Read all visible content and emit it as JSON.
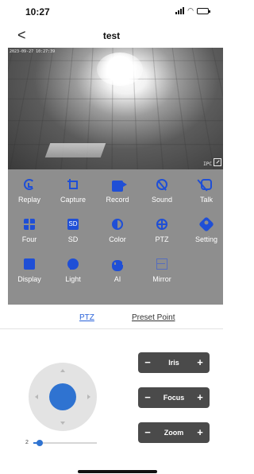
{
  "status_bar": {
    "time": "10:27"
  },
  "nav": {
    "back_glyph": "<",
    "title": "test"
  },
  "video": {
    "osd_top_left": "2023-09-27 10:27:39",
    "osd_bottom_right": "IPC"
  },
  "controls": {
    "row1": [
      {
        "label": "Replay",
        "icon": "replay-icon"
      },
      {
        "label": "Capture",
        "icon": "capture-icon"
      },
      {
        "label": "Record",
        "icon": "record-icon"
      },
      {
        "label": "Sound",
        "icon": "sound-off-icon"
      },
      {
        "label": "Talk",
        "icon": "talk-off-icon"
      }
    ],
    "row2": [
      {
        "label": "Four",
        "icon": "four-grid-icon"
      },
      {
        "label": "SD",
        "icon": "sd-icon",
        "badge": "SD"
      },
      {
        "label": "Color",
        "icon": "color-icon"
      },
      {
        "label": "PTZ",
        "icon": "ptz-icon"
      },
      {
        "label": "Setting",
        "icon": "gear-icon"
      }
    ],
    "row3": [
      {
        "label": "Display",
        "icon": "display-icon"
      },
      {
        "label": "Light",
        "icon": "light-bulb-icon"
      },
      {
        "label": "AI",
        "icon": "ai-icon"
      },
      {
        "label": "Mirror",
        "icon": "mirror-icon"
      }
    ]
  },
  "tabs": {
    "ptz": "PTZ",
    "preset": "Preset Point",
    "active": "ptz"
  },
  "ptz": {
    "speed": "2",
    "speed_fraction": 0.1,
    "iris": {
      "minus": "−",
      "label": "Iris",
      "plus": "+"
    },
    "focus": {
      "minus": "−",
      "label": "Focus",
      "plus": "+"
    },
    "zoom": {
      "minus": "−",
      "label": "Zoom",
      "plus": "+"
    }
  },
  "colors": {
    "accent": "#2f73d1",
    "icon_blue": "#1f4fd6",
    "panel": "#8e8e8e",
    "pill": "#4a4a4a"
  }
}
